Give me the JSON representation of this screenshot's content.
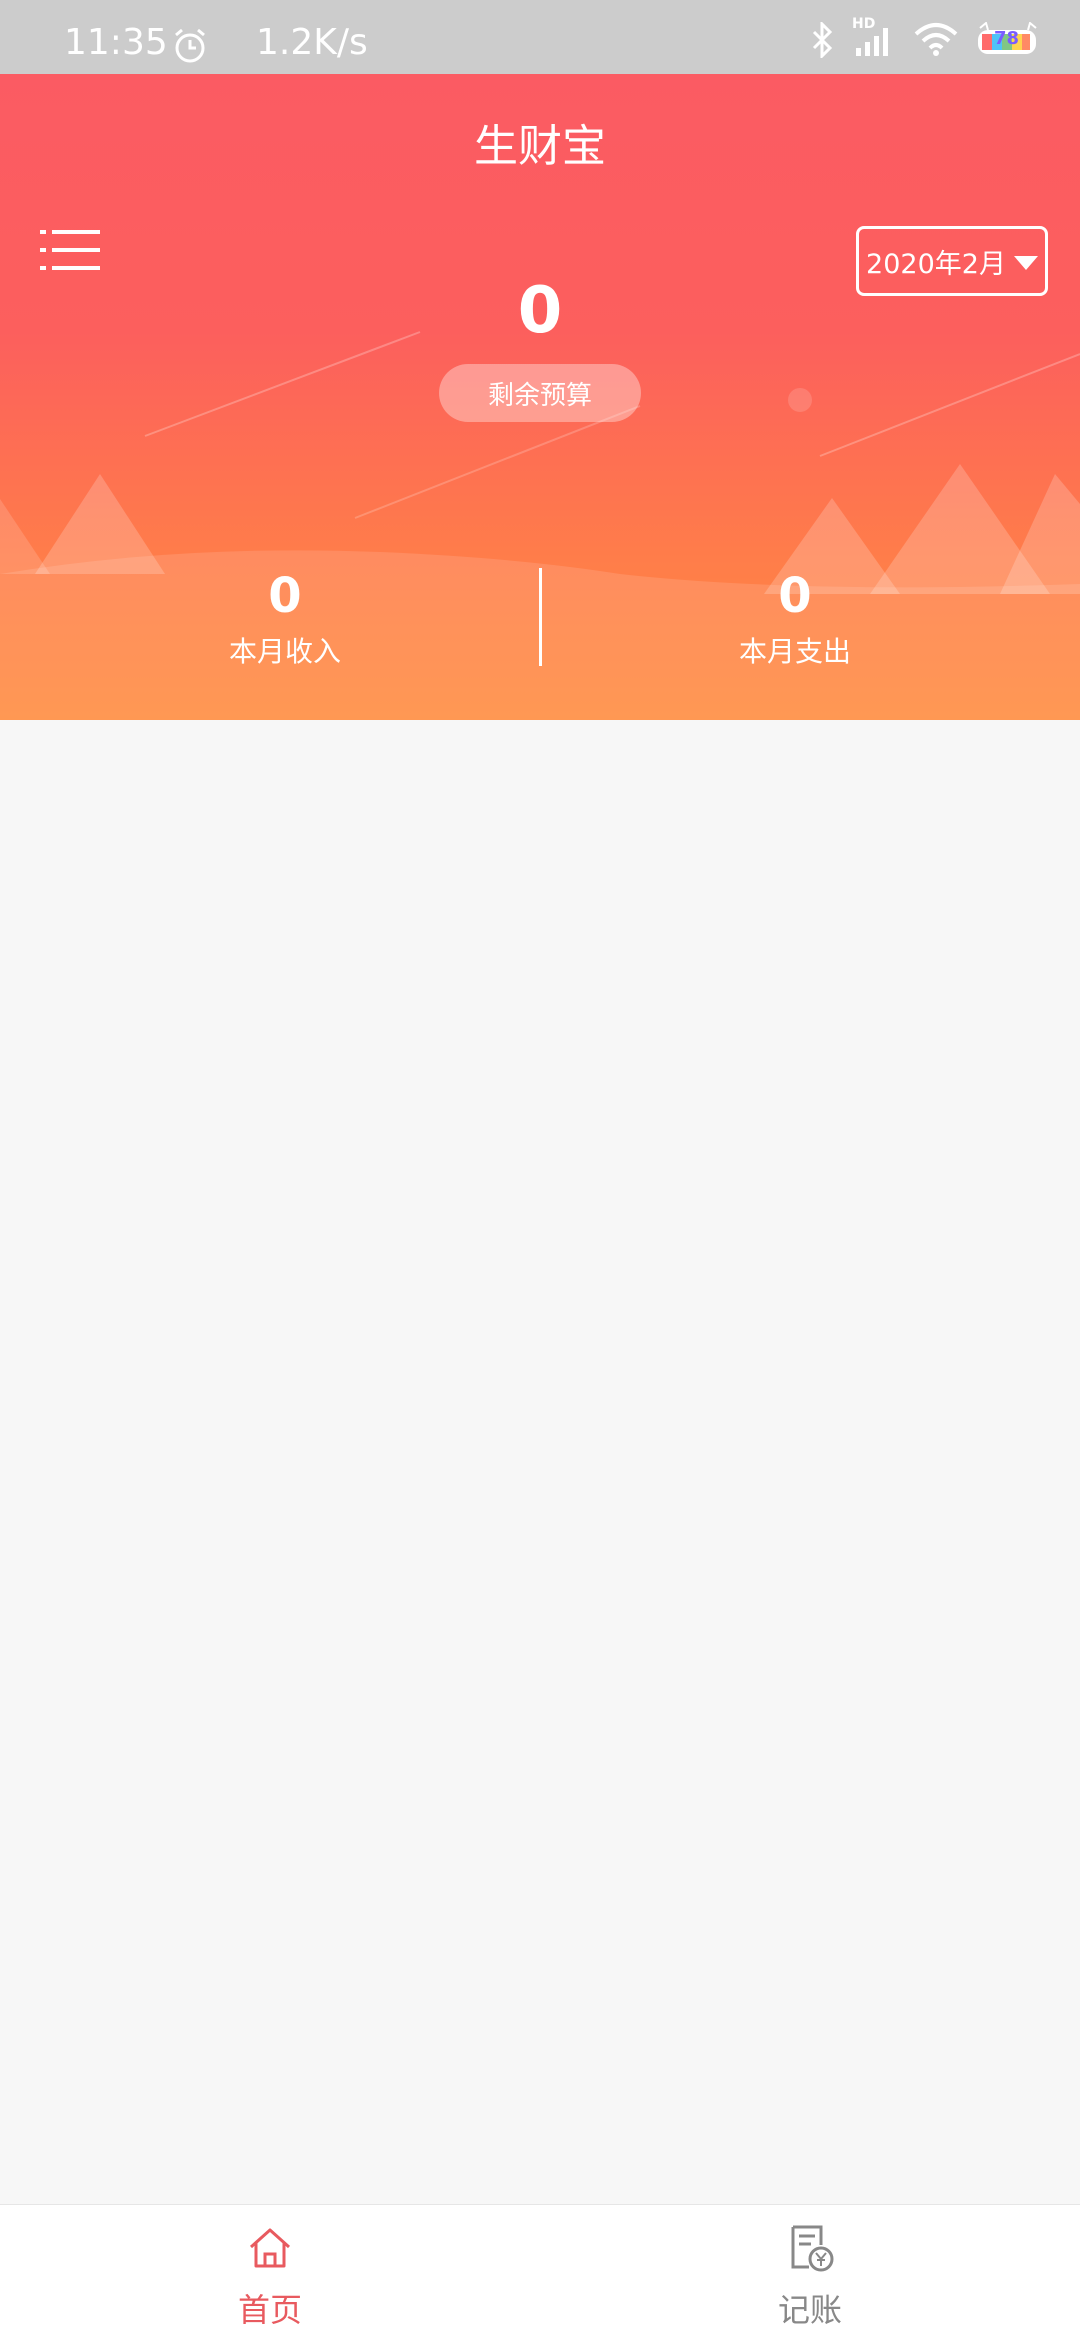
{
  "status_bar": {
    "time": "11:35",
    "net_speed": "1.2K/s",
    "hd_label": "HD",
    "battery": "78"
  },
  "header": {
    "title": "生财宝",
    "month_selector": "2020年2月"
  },
  "budget": {
    "value": "0",
    "label": "剩余预算"
  },
  "stats": {
    "income_value": "0",
    "income_label": "本月收入",
    "expense_value": "0",
    "expense_label": "本月支出"
  },
  "tabbar": {
    "home_label": "首页",
    "book_label": "记账"
  },
  "colors": {
    "gradient_top": "#fb5b63",
    "gradient_bottom": "#ff8a3c",
    "active_tab": "#e85a5f",
    "inactive_tab": "#888888"
  }
}
